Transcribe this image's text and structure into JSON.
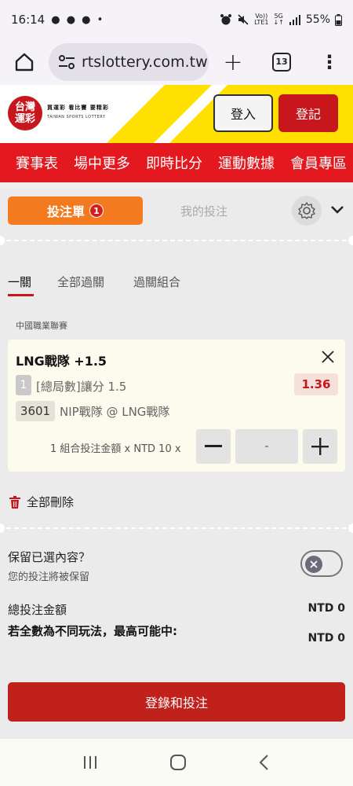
{
  "status_bar": {
    "time": "16:14",
    "notif_icons": "● ● ● •",
    "lte_top": "Vo))",
    "lte_bottom": "LTE1",
    "net_top": "5G",
    "net_bottom": "↓↑",
    "battery": "55%"
  },
  "browser": {
    "url": "rtslottery.com.tw",
    "tab_count": "13"
  },
  "site": {
    "logo_line1": "台灣",
    "logo_line2": "運彩",
    "tagline": "買運彩 看比賽 要精彩",
    "subtitle": "TAIWAN SPORTS LOTTERY",
    "login": "登入",
    "register": "登記"
  },
  "nav": [
    "賽事表",
    "場中更多",
    "即時比分",
    "運動數據",
    "會員專區"
  ],
  "betslip": {
    "tab_label": "投注單",
    "badge": "1",
    "my_bets": "我的投注"
  },
  "subtabs": [
    "一關",
    "全部過關",
    "過關組合"
  ],
  "league": "中國職業聯賽",
  "bet": {
    "selection": "LNG戰隊 +1.5",
    "market_num": "1",
    "market": "[總局數]讓分 1.5",
    "odds": "1.36",
    "code": "3601",
    "match": "NIP戰隊 @ LNG戰隊",
    "stake_label": "1 組合投注金額 x NTD 10 x",
    "stake_value": "-"
  },
  "delete_all": "全部刪除",
  "keep": {
    "title": "保留已選內容？",
    "subtitle": "您的投注將被保留"
  },
  "totals": {
    "total_label": "總投注金額",
    "total_value": "NTD 0",
    "max_label": "若全數為不同玩法，最高可能中:",
    "max_value": "NTD 0"
  },
  "submit": "登錄和投注",
  "colors": {
    "brand_red": "#e3191f",
    "orange": "#f47a1f",
    "yellow": "#ffe000"
  }
}
